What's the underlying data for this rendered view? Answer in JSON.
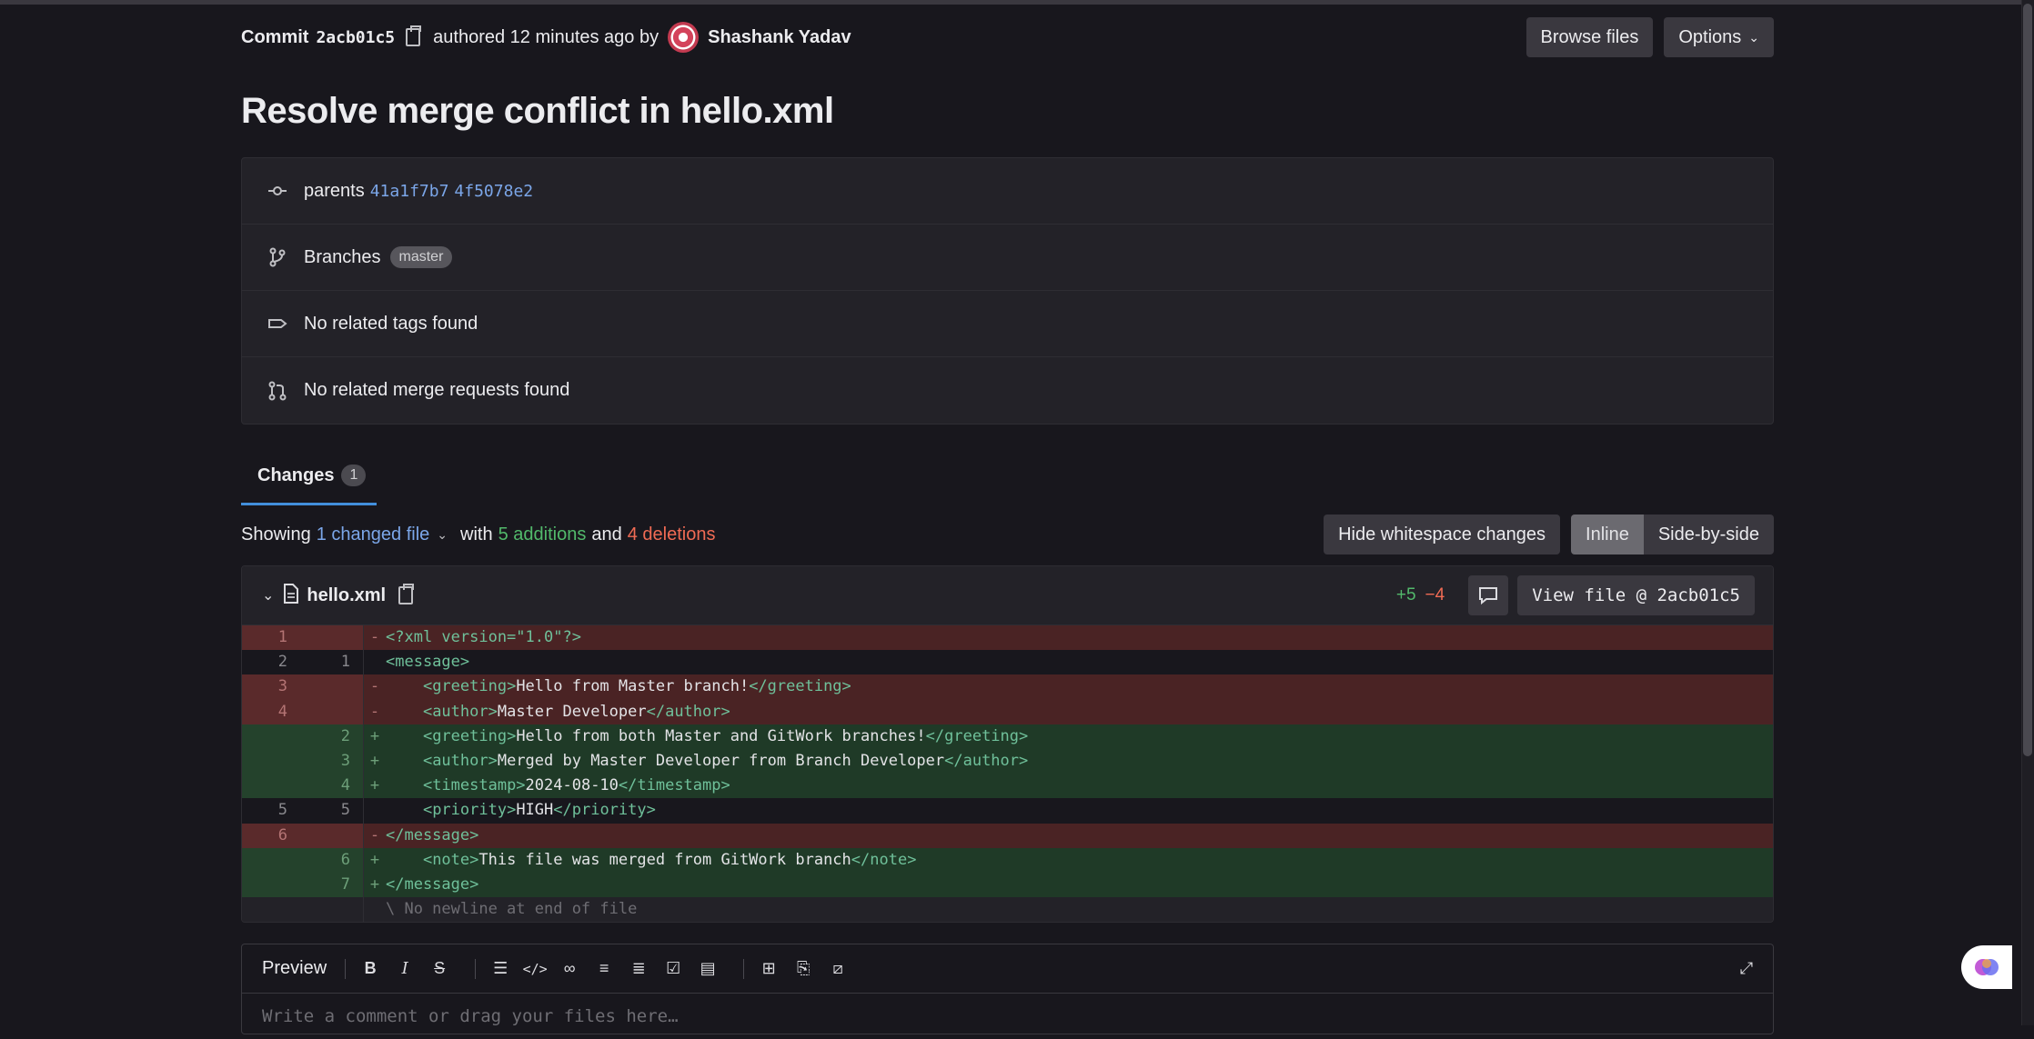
{
  "header": {
    "commit_label": "Commit",
    "commit_sha": "2acb01c5",
    "authored_text": "authored 12 minutes ago by",
    "author_name": "Shashank Yadav",
    "browse_files": "Browse files",
    "options": "Options"
  },
  "title": "Resolve merge conflict in hello.xml",
  "info": {
    "parents_label": "parents",
    "parent1": "41a1f7b7",
    "parent2": "4f5078e2",
    "branches_label": "Branches",
    "branch_badge": "master",
    "tags_text": "No related tags found",
    "mr_text": "No related merge requests found"
  },
  "tabs": {
    "changes_label": "Changes",
    "changes_count": "1"
  },
  "summary": {
    "showing": "Showing",
    "changed_files": "1 changed file",
    "with": "with",
    "additions": "5 additions",
    "and": "and",
    "deletions": "4 deletions",
    "hide_whitespace": "Hide whitespace changes",
    "inline": "Inline",
    "side_by_side": "Side-by-side"
  },
  "file": {
    "name": "hello.xml",
    "added": "+5",
    "removed": "−4",
    "view_file": "View file @ 2acb01c5",
    "no_newline": "\\ No newline at end of file",
    "lines": [
      {
        "type": "del",
        "old": "1",
        "new": "",
        "sign": "-",
        "code": "<?xml version=\"1.0\"?>"
      },
      {
        "type": "ctx",
        "old": "2",
        "new": "1",
        "sign": "",
        "code": "<message>"
      },
      {
        "type": "del",
        "old": "3",
        "new": "",
        "sign": "-",
        "code": "    <greeting>Hello from Master branch!</greeting>"
      },
      {
        "type": "del",
        "old": "4",
        "new": "",
        "sign": "-",
        "code": "    <author>Master Developer</author>"
      },
      {
        "type": "add",
        "old": "",
        "new": "2",
        "sign": "+",
        "code": "    <greeting>Hello from both Master and GitWork branches!</greeting>"
      },
      {
        "type": "add",
        "old": "",
        "new": "3",
        "sign": "+",
        "code": "    <author>Merged by Master Developer from Branch Developer</author>"
      },
      {
        "type": "add",
        "old": "",
        "new": "4",
        "sign": "+",
        "code": "    <timestamp>2024-08-10</timestamp>"
      },
      {
        "type": "ctx",
        "old": "5",
        "new": "5",
        "sign": "",
        "code": "    <priority>HIGH</priority>"
      },
      {
        "type": "del",
        "old": "6",
        "new": "",
        "sign": "-",
        "code": "</message>"
      },
      {
        "type": "add",
        "old": "",
        "new": "6",
        "sign": "+",
        "code": "    <note>This file was merged from GitWork branch</note>"
      },
      {
        "type": "add",
        "old": "",
        "new": "7",
        "sign": "+",
        "code": "</message>"
      }
    ]
  },
  "editor": {
    "preview_tab": "Preview",
    "placeholder": "Write a comment or drag your files here…"
  },
  "colors": {
    "background": "#18171d",
    "panel": "#232228",
    "link": "#7ba6e8",
    "addition": "#52b96b",
    "deletion": "#f06b54",
    "tab_underline": "#428fdc"
  },
  "icons": {
    "copy": "copy-icon",
    "commit": "commit-icon",
    "branch": "branch-icon",
    "tag": "tag-icon",
    "merge_request": "merge-request-icon",
    "chevron": "chevron-down-icon",
    "file": "file-icon",
    "comment": "comment-icon",
    "fullscreen": "fullscreen-icon",
    "duo": "duo-chat-icon"
  }
}
